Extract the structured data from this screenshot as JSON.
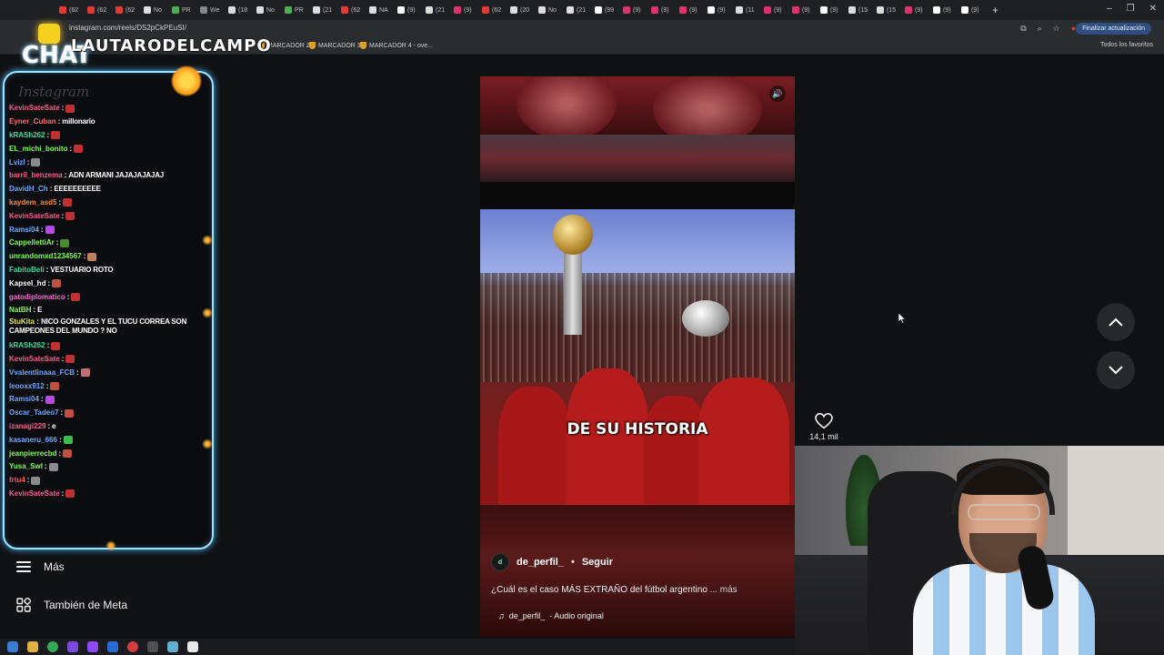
{
  "browser": {
    "url": "instagram.com/reels/DS2pCkPEuSI/",
    "update_button": "Finalizar actualización",
    "bookmarks": [
      {
        "label": "MARCADOR 2"
      },
      {
        "label": "MARCADOR 3"
      },
      {
        "label": "MARCADOR 4 - ove..."
      }
    ],
    "bookmarks_all": "Todos los favoritos",
    "tabs": [
      {
        "label": "(62",
        "color": "#e53935"
      },
      {
        "label": "(62",
        "color": "#e53935"
      },
      {
        "label": "(62",
        "color": "#e53935"
      },
      {
        "label": "No",
        "color": "#dddddd"
      },
      {
        "label": "PR",
        "color": "#4caf50"
      },
      {
        "label": "We",
        "color": "#888888"
      },
      {
        "label": "(18",
        "color": "#dddddd"
      },
      {
        "label": "No",
        "color": "#dddddd"
      },
      {
        "label": "PR",
        "color": "#4caf50"
      },
      {
        "label": "(21",
        "color": "#dddddd"
      },
      {
        "label": "(62",
        "color": "#e53935"
      },
      {
        "label": "NA",
        "color": "#dddddd"
      },
      {
        "label": "(9)",
        "color": "#ffffff"
      },
      {
        "label": "(21",
        "color": "#dddddd"
      },
      {
        "label": "(9)",
        "color": "#e1306c"
      },
      {
        "label": "(62",
        "color": "#e53935"
      },
      {
        "label": "(20",
        "color": "#dddddd"
      },
      {
        "label": "No",
        "color": "#dddddd"
      },
      {
        "label": "(21",
        "color": "#dddddd"
      },
      {
        "label": "(99",
        "color": "#ffffff"
      },
      {
        "label": "(9)",
        "color": "#e1306c"
      },
      {
        "label": "(9)",
        "color": "#e1306c"
      },
      {
        "label": "(9)",
        "color": "#e1306c"
      },
      {
        "label": "(9)",
        "color": "#ffffff"
      },
      {
        "label": "(11",
        "color": "#dddddd"
      },
      {
        "label": "(9)",
        "color": "#e1306c"
      },
      {
        "label": "(9)",
        "color": "#e1306c"
      },
      {
        "label": "(9)",
        "color": "#ffffff"
      },
      {
        "label": "(15",
        "color": "#dddddd"
      },
      {
        "label": "(15",
        "color": "#dddddd"
      },
      {
        "label": "(9)",
        "color": "#e1306c"
      },
      {
        "label": "(9)",
        "color": "#ffffff"
      },
      {
        "label": "(9)",
        "color": "#ffffff"
      }
    ]
  },
  "overlay": {
    "streamer_name": "LAUTARODELCAMPO",
    "chat_title": "CHAT",
    "ghost_logo": "Instagram"
  },
  "chat": [
    {
      "user": "KevinSateSate",
      "color": "#ff5a8a",
      "text": "",
      "emote": "#c03030"
    },
    {
      "user": "Eyner_Cuban",
      "color": "#ff6a6a",
      "text": "millonario",
      "emote": ""
    },
    {
      "user": "kRASh262",
      "color": "#3adfa0",
      "text": "",
      "emote": "#c03030"
    },
    {
      "user": "EL_michi_bonito",
      "color": "#7dff4a",
      "text": "",
      "emote": "#c03030"
    },
    {
      "user": "Lvizl",
      "color": "#6aa8ff",
      "text": "",
      "emote": "#8a8a8a"
    },
    {
      "user": "barril_benzema",
      "color": "#ff5a8a",
      "text": "ADN ARMANI JAJAJAJAJAJ",
      "emote": ""
    },
    {
      "user": "DavidH_Ch",
      "color": "#6aa8ff",
      "text": "EEEEEEEEEE",
      "emote": ""
    },
    {
      "user": "kaydem_asd5",
      "color": "#ff8a3a",
      "text": "",
      "emote": "#c03030"
    },
    {
      "user": "KevinSateSate",
      "color": "#ff5a8a",
      "text": "",
      "emote": "#c03030"
    },
    {
      "user": "Ramsi04",
      "color": "#6aa8ff",
      "text": "",
      "emote": "#b44ae0"
    },
    {
      "user": "CappellettiAr",
      "color": "#7dff4a",
      "text": "",
      "emote": "#4a8a30"
    },
    {
      "user": "unrandomxd1234567",
      "color": "#7dff4a",
      "text": "",
      "emote": "#c08060"
    },
    {
      "user": "FabitoBeli",
      "color": "#3adfa0",
      "text": "VESTUARIO ROTO",
      "emote": ""
    },
    {
      "user": "Kapsel_hd",
      "color": "#ffffff",
      "text": "",
      "emote": "#c05040"
    },
    {
      "user": "gatodiplomatico",
      "color": "#ff6ad0",
      "text": "",
      "emote": "#c03030"
    },
    {
      "user": "NatBH",
      "color": "#7dff4a",
      "text": "E",
      "emote": ""
    },
    {
      "user": "StuKita",
      "color": "#e6e64a",
      "text": "NICO GONZALES Y EL TUCU CORREA SON CAMPEONES DEL MUNDO ? NO",
      "emote": "",
      "wrap": true
    },
    {
      "user": "kRASh262",
      "color": "#3adfa0",
      "text": "",
      "emote": "#c03030"
    },
    {
      "user": "KevinSateSate",
      "color": "#ff5a8a",
      "text": "",
      "emote": "#c03030"
    },
    {
      "user": "Vvalentlinaaa_FCB",
      "color": "#6aa8ff",
      "text": "",
      "emote": "#c07070"
    },
    {
      "user": "leooxx912",
      "color": "#6aa8ff",
      "text": "",
      "emote": "#c05040"
    },
    {
      "user": "Ramsi04",
      "color": "#6aa8ff",
      "text": "",
      "emote": "#b44ae0"
    },
    {
      "user": "Oscar_Tadeo7",
      "color": "#6aa8ff",
      "text": "",
      "emote": "#c05040"
    },
    {
      "user": "izanagi229",
      "color": "#ff5a8a",
      "text": "e",
      "emote": ""
    },
    {
      "user": "kasaneru_666",
      "color": "#6aa8ff",
      "text": "",
      "emote": "#3ac04a"
    },
    {
      "user": "jeanpierrecbd",
      "color": "#7dff4a",
      "text": "",
      "emote": "#c05040"
    },
    {
      "user": "Yusa_Swl",
      "color": "#7dff4a",
      "text": "",
      "emote": "#8a8a8a"
    },
    {
      "user": "frtu4",
      "color": "#ff5a5a",
      "text": "",
      "emote": "#8a8a8a"
    },
    {
      "user": "KevinSateSate",
      "color": "#ff5a8a",
      "text": "",
      "emote": "#c03030"
    }
  ],
  "sidebar": {
    "more_label": "Más",
    "meta_label": "También de Meta"
  },
  "reel": {
    "caption_overlay": "DE SU HISTORIA",
    "author": "de_perfil_",
    "follow": "Seguir",
    "description": "¿Cuál es el caso MÁS EXTRAÑO del fútbol argentino",
    "more": "... más",
    "audio_author": "de_perfil_",
    "audio_label": "· Audio original",
    "like_count": "14,1 mil"
  }
}
